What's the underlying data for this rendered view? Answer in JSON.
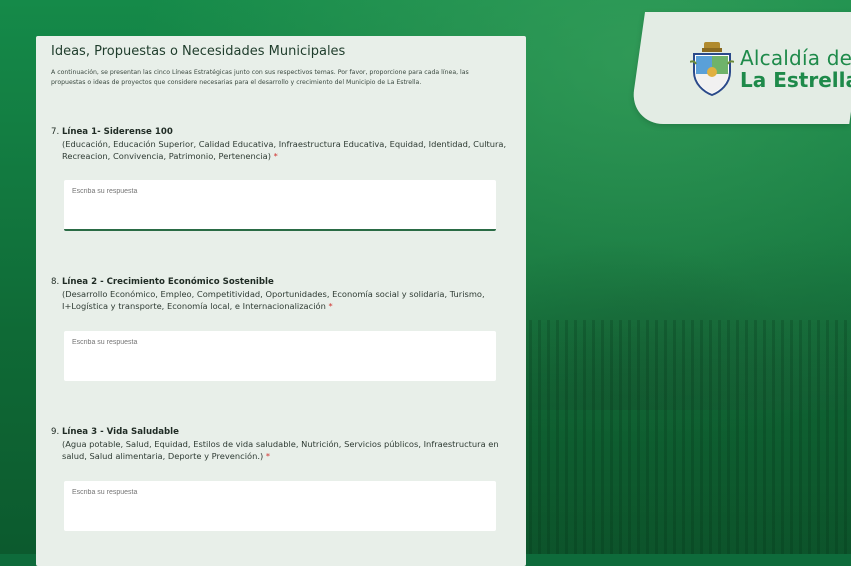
{
  "brand": {
    "line1": "Alcaldía de",
    "line2": "La Estrella",
    "color": "#1e8a4a"
  },
  "form": {
    "title": "Ideas, Propuestas o Necesidades Municipales",
    "intro": "A continuación, se presentan las cinco Líneas Estratégicas junto con sus respectivos temas. Por favor, proporcione para cada línea, las propuestas o ideas de proyectos que considere necesarias para el desarrollo y crecimiento del Municipio de La Estrella.",
    "questions": [
      {
        "number": "7.",
        "title": "Línea 1- Siderense 100",
        "subtitle": "(Educación, Educación Superior, Calidad Educativa, Infraestructura Educativa, Equidad, Identidad, Cultura, Recreacion, Convivencia, Patrimonio, Pertenencia)",
        "required": "*",
        "placeholder": "Escriba su respuesta"
      },
      {
        "number": "8.",
        "title": "Línea 2 - Crecimiento Económico Sostenible",
        "subtitle": "(Desarrollo Económico, Empleo, Competitividad, Oportunidades, Economía social y solidaria, Turismo, I+Logística y transporte, Economía local, e Internacionalización",
        "required": "*",
        "placeholder": "Escriba su respuesta"
      },
      {
        "number": "9.",
        "title": "Línea 3 - Vida Saludable",
        "subtitle": "(Agua potable, Salud, Equidad, Estilos de vida saludable, Nutrición, Servicios públicos, Infraestructura en salud, Salud alimentaria, Deporte y Prevención.)",
        "required": "*",
        "placeholder": "Escriba su respuesta"
      }
    ]
  }
}
